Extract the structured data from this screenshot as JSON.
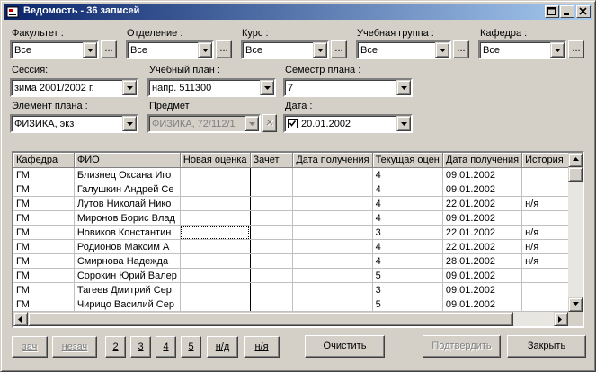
{
  "window": {
    "title": "Ведомость - 36 записей"
  },
  "filters": {
    "faculty": {
      "label": "Факультет :",
      "value": "Все"
    },
    "department": {
      "label": "Отделение :",
      "value": "Все"
    },
    "course": {
      "label": "Курс :",
      "value": "Все"
    },
    "group": {
      "label": "Учебная группа :",
      "value": "Все"
    },
    "chair": {
      "label": "Кафедра :",
      "value": "Все"
    },
    "session": {
      "label": "Сессия:",
      "value": "зима 2001/2002 г."
    },
    "plan": {
      "label": "Учебный план :",
      "value": "напр. 511300"
    },
    "semester": {
      "label": "Семестр плана :",
      "value": "7"
    },
    "plan_element": {
      "label": "Элемент плана :",
      "value": "ФИЗИКА, экз"
    },
    "subject": {
      "label": "Предмет",
      "value": "ФИЗИКА, 72/112/1"
    },
    "date": {
      "label": "Дата :",
      "value": "20.01.2002",
      "checked": true
    },
    "ellipsis": "...",
    "clear_x": "✕"
  },
  "grid": {
    "columns": [
      "Кафедра",
      "ФИО",
      "Новая оценка",
      "Зачет",
      "Дата получения",
      "Текущая оцен",
      "Дата получения",
      "История"
    ],
    "rows": [
      [
        "ГМ",
        "Близнец Оксана Иго",
        "",
        "",
        "",
        "4",
        "09.01.2002",
        ""
      ],
      [
        "ГМ",
        "Галушкин Андрей Се",
        "",
        "",
        "",
        "4",
        "09.01.2002",
        ""
      ],
      [
        "ГМ",
        "Лутов Николай Нико",
        "",
        "",
        "",
        "4",
        "22.01.2002",
        "н/я"
      ],
      [
        "ГМ",
        "Миронов Борис Влад",
        "",
        "",
        "",
        "4",
        "09.01.2002",
        ""
      ],
      [
        "ГМ",
        "Новиков Константин",
        "",
        "",
        "",
        "3",
        "22.01.2002",
        "н/я"
      ],
      [
        "ГМ",
        "Родионов Максим А",
        "",
        "",
        "",
        "4",
        "22.01.2002",
        "н/я"
      ],
      [
        "ГМ",
        "Смирнова Надежда",
        "",
        "",
        "",
        "4",
        "28.01.2002",
        "н/я"
      ],
      [
        "ГМ",
        "Сорокин Юрий Валер",
        "",
        "",
        "",
        "5",
        "09.01.2002",
        ""
      ],
      [
        "ГМ",
        "Тагеев Дмитрий Сер",
        "",
        "",
        "",
        "3",
        "09.01.2002",
        ""
      ],
      [
        "ГМ",
        "Чирицо Василий Сер",
        "",
        "",
        "",
        "5",
        "09.01.2002",
        ""
      ]
    ]
  },
  "buttons": {
    "zach": "зач",
    "nezach": "незач",
    "g2": "2",
    "g3": "3",
    "g4": "4",
    "g5": "5",
    "nd": "н/д",
    "nya": "н/я",
    "clear": "Очистить",
    "confirm": "Подтвердить",
    "close": "Закрыть"
  }
}
